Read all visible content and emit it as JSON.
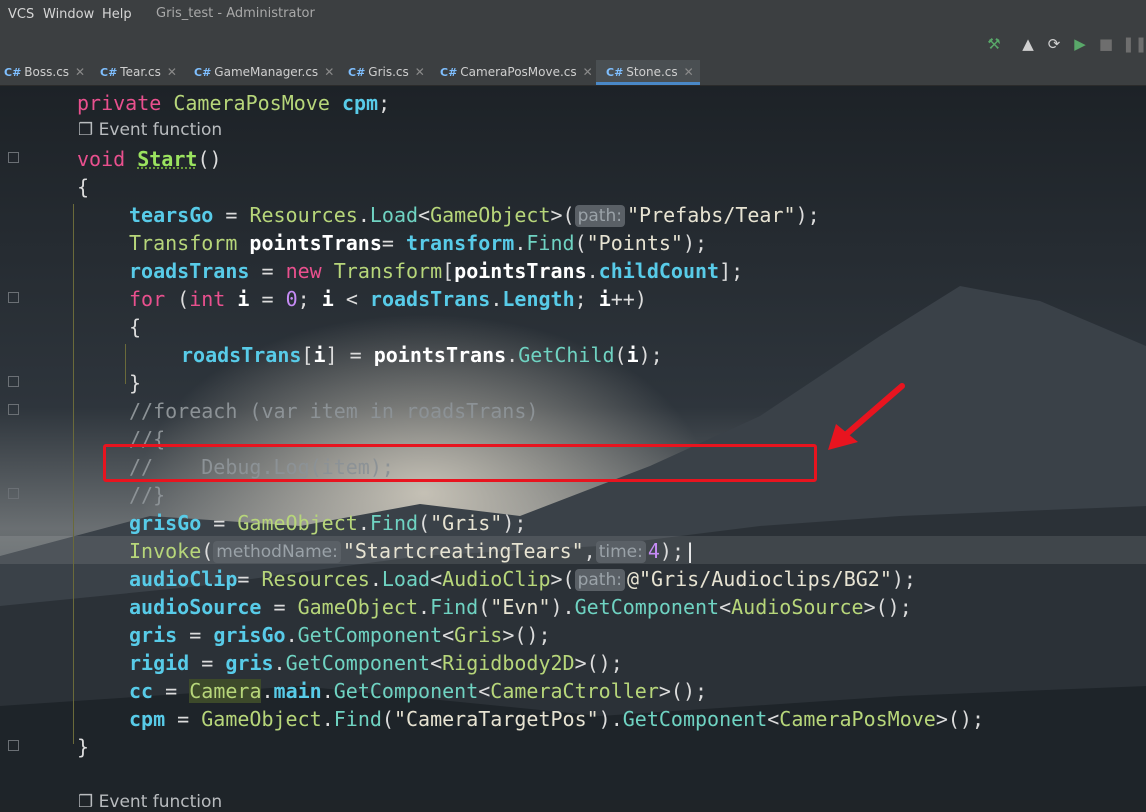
{
  "menubar": {
    "items": [
      "VCS",
      "Window",
      "Help"
    ],
    "title": "Gris_test - Administrator"
  },
  "toolbar": {
    "icons": [
      "build-hammer-icon",
      "unity-icon",
      "refresh-unity-icon",
      "run-icon",
      "stop-icon",
      "pause-icon"
    ]
  },
  "tabs": [
    {
      "label": "Boss.cs",
      "prefix": "C#"
    },
    {
      "label": "Tear.cs",
      "prefix": "C#"
    },
    {
      "label": "GameManager.cs",
      "prefix": "C#"
    },
    {
      "label": "Gris.cs",
      "prefix": "C#"
    },
    {
      "label": "CameraPosMove.cs",
      "prefix": "C#"
    },
    {
      "label": "Stone.cs",
      "prefix": "C#",
      "active": true
    }
  ],
  "editor": {
    "event_hint": "Event function",
    "event_hint_bottom": "Event function",
    "hints": {
      "path": "path:",
      "methodName": "methodName:",
      "time": "time:"
    },
    "code": {
      "l1_kw": "private",
      "l1_type": "CameraPosMove",
      "l1_name": "cpm",
      "l2_kw": "void",
      "l2_name": "Start",
      "l2_paren": "()",
      "brace_open": "{",
      "brace_close": "}",
      "l3_field": "tearsGo",
      "l3_cls": "Resources",
      "l3_m": "Load",
      "l3_gen": "GameObject",
      "l3_str": "\"Prefabs/Tear\"",
      "l4_type": "Transform",
      "l4_var": "pointsTrans",
      "l4_f": "transform",
      "l4_m": "Find",
      "l4_str": "\"Points\"",
      "l5_field": "roadsTrans",
      "l5_kw": "new",
      "l5_type": "Transform",
      "l5_var": "pointsTrans",
      "l5_prop": "childCount",
      "l6_kw": "for",
      "l6_int": "int",
      "l6_i": "i",
      "l6_zero": "0",
      "l6_field": "roadsTrans",
      "l6_prop": "Length",
      "l7_field": "roadsTrans",
      "l7_i": "i",
      "l7_var": "pointsTrans",
      "l7_m": "GetChild",
      "c1": "//foreach (var item in roadsTrans)",
      "c2": "//{",
      "c3": "//    Debug.Log(item);",
      "c4": "//}",
      "l8_field": "grisGo",
      "l8_cls": "GameObject",
      "l8_m": "Find",
      "l8_str": "\"Gris\"",
      "l9_m": "Invoke",
      "l9_str": "\"StartcreatingTears\"",
      "l9_num": "4",
      "l10_field": "audioClip",
      "l10_cls": "Resources",
      "l10_m": "Load",
      "l10_gen": "AudioClip",
      "l10_str": "@\"Gris/Audioclips/BG2\"",
      "l11_field": "audioSource",
      "l11_cls": "GameObject",
      "l11_m": "Find",
      "l11_str": "\"Evn\"",
      "l11_m2": "GetComponent",
      "l11_gen": "AudioSource",
      "l12_field": "gris",
      "l12_var": "grisGo",
      "l12_m": "GetComponent",
      "l12_gen": "Gris",
      "l13_field": "rigid",
      "l13_var": "gris",
      "l13_m": "GetComponent",
      "l13_gen": "Rigidbody2D",
      "l14_field": "cc",
      "l14_cls": "Camera",
      "l14_prop": "main",
      "l14_m": "GetComponent",
      "l14_gen": "CameraCtroller",
      "l15_field": "cpm",
      "l15_cls": "GameObject",
      "l15_m": "Find",
      "l15_str": "\"CameraTargetPos\"",
      "l15_m2": "GetComponent",
      "l15_gen": "CameraPosMove"
    }
  }
}
